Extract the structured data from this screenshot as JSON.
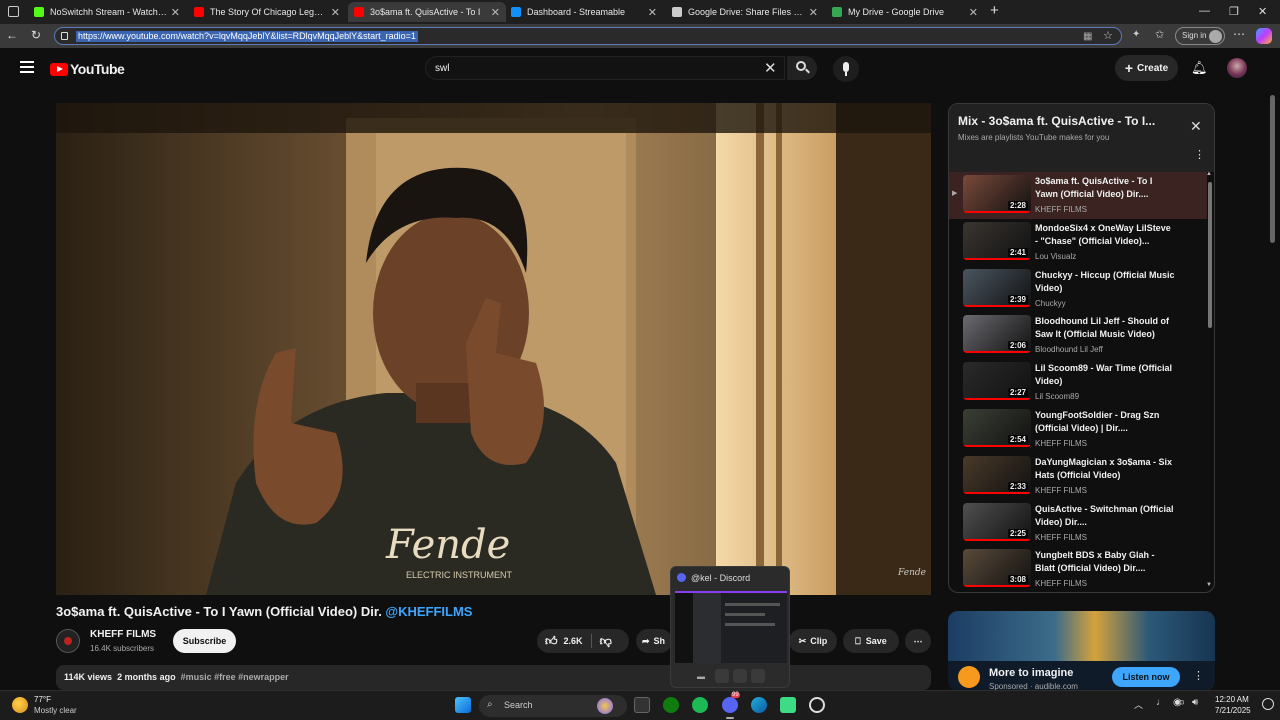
{
  "browser": {
    "tabs": [
      {
        "title": "NoSwitchh Stream - Watch Live o",
        "color": "#53fc18",
        "active": false
      },
      {
        "title": "The Story Of Chicago Legend Lil Y",
        "color": "#ff0000",
        "active": false
      },
      {
        "title": "3o$ama ft. QuisActive - To I",
        "color": "#ff0000",
        "active": true
      },
      {
        "title": "Dashboard - Streamable",
        "color": "#0f90fa",
        "active": false
      },
      {
        "title": "Google Drive: Share Files Online w",
        "color": "#cccccc",
        "active": false
      },
      {
        "title": "My Drive - Google Drive",
        "color": "#34a853",
        "active": false
      }
    ],
    "url": "https://www.youtube.com/watch?v=lqvMqqJeblY&list=RDlqvMqqJeblY&start_radio=1",
    "sign_in_label": "Sign in"
  },
  "youtube": {
    "logo_text": "YouTube",
    "search_value": "swl",
    "create_label": "Create"
  },
  "video": {
    "title_main": "3o$ama ft. QuisActive - To I Yawn (Official Video) Dir. ",
    "title_tag": "@KHEFFILMS",
    "hoodie_text": "Fende",
    "hoodie_sub": "ELECTRIC INSTRUMENT",
    "watermark": "Fende",
    "channel": "KHEFF FILMS",
    "subscribers": "16.4K subscribers",
    "subscribe_label": "Subscribe",
    "likes": "2.6K",
    "share_label": "Sh",
    "clip_label": "Clip",
    "save_label": "Save",
    "views": "114K views",
    "age": "2 months ago",
    "hashtags": "#music #free #newrapper"
  },
  "playlist": {
    "title": "Mix - 3o$ama ft. QuisActive - To I...",
    "subtitle": "Mixes are playlists YouTube makes for you",
    "items": [
      {
        "title": "3o$ama ft. QuisActive - To I Yawn (Official Video) Dir....",
        "channel": "KHEFF FILMS",
        "duration": "2:28",
        "current": true,
        "color": "#7a4a3a"
      },
      {
        "title": "MondoeSix4 x OneWay LilSteve - \"Chase\" (Official Video)...",
        "channel": "Lou Visualz",
        "duration": "2:41",
        "current": false,
        "color": "#3a3530"
      },
      {
        "title": "Chuckyy - Hiccup (Official Music Video)",
        "channel": "Chuckyy",
        "duration": "2:39",
        "current": false,
        "color": "#4a5560"
      },
      {
        "title": "Bloodhound Lil Jeff - Should of Saw It (Official Music Video)",
        "channel": "Bloodhound Lil Jeff",
        "duration": "2:06",
        "current": false,
        "color": "#6a6a70"
      },
      {
        "title": "Lil Scoom89 - War Time (Official Video)",
        "channel": "Lil Scoom89",
        "duration": "2:27",
        "current": false,
        "color": "#2a2a2a"
      },
      {
        "title": "YoungFootSoldier - Drag Szn (Official Video) | Dir....",
        "channel": "KHEFF FILMS",
        "duration": "2:54",
        "current": false,
        "color": "#3a4035"
      },
      {
        "title": "DaYungMagician x 3o$ama - Six Hats (Official Video)",
        "channel": "KHEFF FILMS",
        "duration": "2:33",
        "current": false,
        "color": "#4a3a2a"
      },
      {
        "title": "QuisActive - Switchman (Official Video) Dir....",
        "channel": "KHEFF FILMS",
        "duration": "2:25",
        "current": false,
        "color": "#505050"
      },
      {
        "title": "Yungbelt BDS x Baby Glah - Blatt (Official Video) Dir....",
        "channel": "KHEFF FILMS",
        "duration": "3:08",
        "current": false,
        "color": "#5a4a3a"
      }
    ]
  },
  "ad": {
    "title": "More to imagine",
    "sponsor": "Sponsored · audible.com",
    "cta": "Listen now"
  },
  "discord_popup": {
    "title": "@kel - Discord"
  },
  "taskbar": {
    "temperature": "77°F",
    "weather": "Mostly clear",
    "search_label": "Search",
    "time": "12:20 AM",
    "date": "7/21/2025",
    "discord_badge": "99"
  }
}
